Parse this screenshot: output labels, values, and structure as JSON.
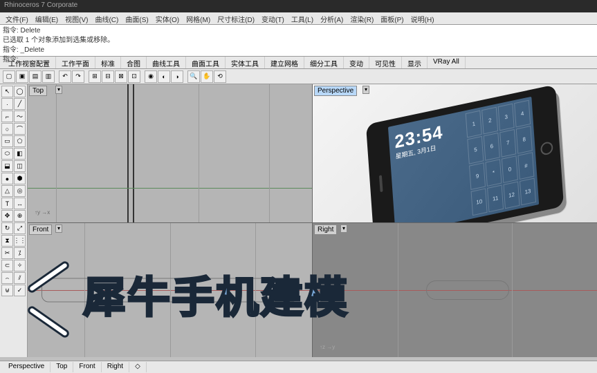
{
  "title": "Rhinoceros 7 Corporate",
  "menu": [
    "文件(F)",
    "编辑(E)",
    "视图(V)",
    "曲线(C)",
    "曲面(S)",
    "实体(O)",
    "网格(M)",
    "尺寸标注(D)",
    "变动(T)",
    "工具(L)",
    "分析(A)",
    "渲染(R)",
    "面板(P)",
    "说明(H)"
  ],
  "cmd": {
    "line1": "指令: Delete",
    "line2": "已选取 1 个对象添加到选集或移除。",
    "line3": "指令: _Delete",
    "prompt": "指令:"
  },
  "tabs": [
    "工作视窗配置",
    "工作平面",
    "标准",
    "合图",
    "曲线工具",
    "曲面工具",
    "实体工具",
    "建立网格",
    "细分工具",
    "变动",
    "可见性",
    "显示",
    "VRay All"
  ],
  "viewports": {
    "tl": "Top",
    "tr": "Perspective",
    "bl": "Front",
    "br": "Right"
  },
  "phone": {
    "time": "23:54",
    "date": "星期五, 3月1日",
    "nums": [
      "1",
      "2",
      "3",
      "4",
      "5",
      "6",
      "7",
      "8",
      "9",
      "*",
      "0",
      "#",
      "10",
      "11",
      "12",
      "13"
    ]
  },
  "status": [
    "Perspective",
    "Top",
    "Front",
    "Right",
    "◇"
  ],
  "overlay_title": "犀牛手机建模"
}
